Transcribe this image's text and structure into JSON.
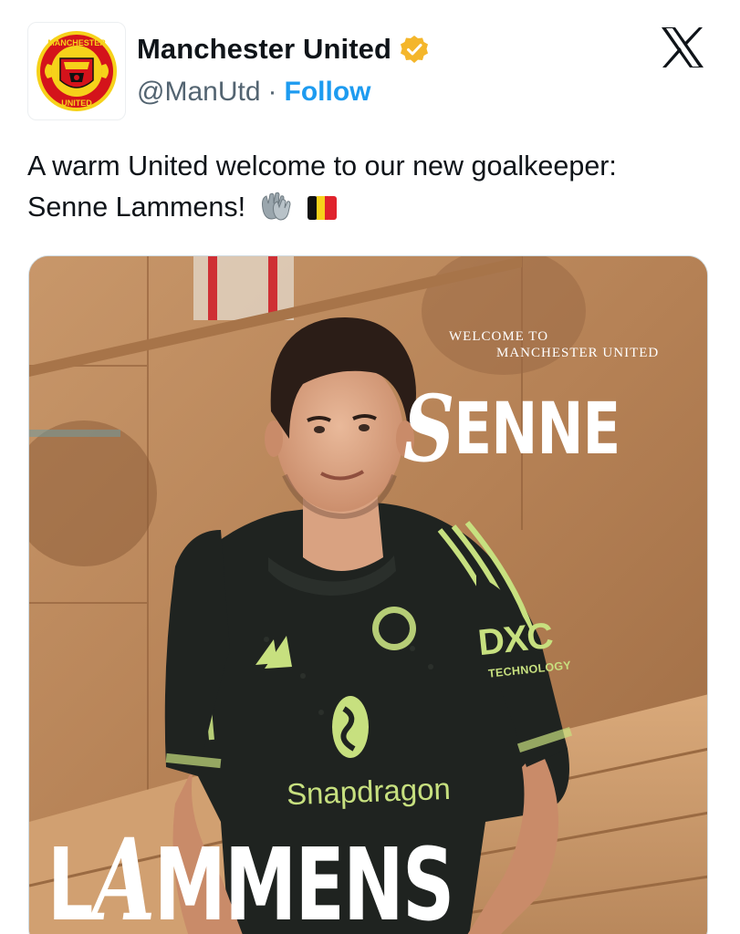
{
  "account": {
    "display_name": "Manchester United",
    "handle": "@ManUtd",
    "separator": "·",
    "follow_label": "Follow",
    "verified": true,
    "avatar_icon": "manchester-united-crest-icon",
    "verified_color": "#f4b62b"
  },
  "platform": {
    "logo_icon": "x-logo-icon"
  },
  "tweet": {
    "line1": "A warm United welcome to our new goalkeeper:",
    "line2": "Senne Lammens!",
    "emojis": [
      "gloves-emoji",
      "belgium-flag-emoji"
    ]
  },
  "media": {
    "welcome_line1": "WELCOME TO",
    "welcome_line2": "MANCHESTER UNITED",
    "first_name_initial": "S",
    "first_name_rest": "ENNE",
    "last_name_first": "L",
    "last_name_initial": "A",
    "last_name_rest": "MMENS",
    "shirt_sponsor": "Snapdragon",
    "sleeve_brand": "DXC",
    "sleeve_text": "TECHNOLOGY",
    "shirt_color": "#1f2320",
    "accent_color": "#c7e07f"
  },
  "colors": {
    "link": "#1d9bf0",
    "text": "#0f1419",
    "muted": "#536471"
  }
}
